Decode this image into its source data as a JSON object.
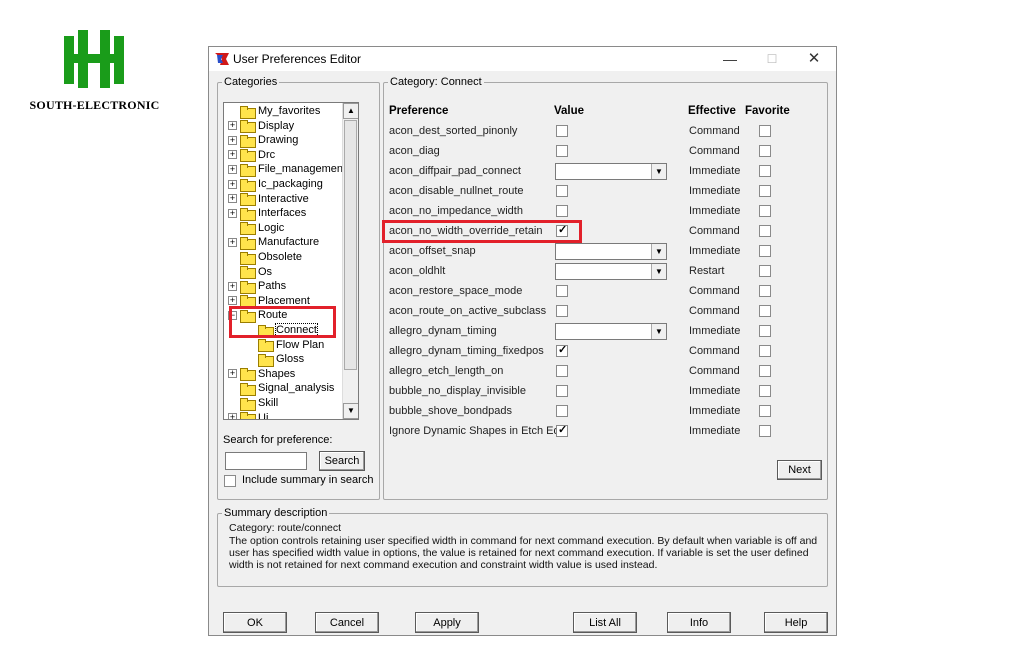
{
  "logo": {
    "text": "SOUTH-ELECTRONIC",
    "brand_color": "#1a9c1a"
  },
  "window": {
    "title": "User Preferences Editor",
    "controls": {
      "minimize": "—",
      "maximize": "☐",
      "close": "✕"
    }
  },
  "categories": {
    "legend": "Categories",
    "items": [
      {
        "label": "My_favorites",
        "expander": ""
      },
      {
        "label": "Display",
        "expander": "+"
      },
      {
        "label": "Drawing",
        "expander": "+"
      },
      {
        "label": "Drc",
        "expander": "+"
      },
      {
        "label": "File_management",
        "expander": "+"
      },
      {
        "label": "Ic_packaging",
        "expander": "+"
      },
      {
        "label": "Interactive",
        "expander": "+"
      },
      {
        "label": "Interfaces",
        "expander": "+"
      },
      {
        "label": "Logic",
        "expander": ""
      },
      {
        "label": "Manufacture",
        "expander": "+"
      },
      {
        "label": "Obsolete",
        "expander": ""
      },
      {
        "label": "Os",
        "expander": ""
      },
      {
        "label": "Paths",
        "expander": "+"
      },
      {
        "label": "Placement",
        "expander": "+"
      },
      {
        "label": "Route",
        "expander": "−"
      },
      {
        "label": "Connect",
        "expander": "",
        "child": true,
        "selected": true
      },
      {
        "label": "Flow Plan",
        "expander": "",
        "child": true
      },
      {
        "label": "Gloss",
        "expander": "",
        "child": true
      },
      {
        "label": "Shapes",
        "expander": "+"
      },
      {
        "label": "Signal_analysis",
        "expander": ""
      },
      {
        "label": "Skill",
        "expander": ""
      },
      {
        "label": "Ui",
        "expander": "+"
      }
    ],
    "search_label": "Search for preference:",
    "search_value": "",
    "search_button": "Search",
    "include_summary_label": "Include summary in search",
    "include_summary_checked": false
  },
  "detail": {
    "legend": "Category:  Connect",
    "headers": {
      "preference": "Preference",
      "value": "Value",
      "effective": "Effective",
      "favorite": "Favorite"
    },
    "rows": [
      {
        "name": "acon_dest_sorted_pinonly",
        "type": "check",
        "checked": false,
        "effective": "Command"
      },
      {
        "name": "acon_diag",
        "type": "check",
        "checked": false,
        "effective": "Command"
      },
      {
        "name": "acon_diffpair_pad_connect",
        "type": "select",
        "value": "",
        "effective": "Immediate"
      },
      {
        "name": "acon_disable_nullnet_route",
        "type": "check",
        "checked": false,
        "effective": "Immediate"
      },
      {
        "name": "acon_no_impedance_width",
        "type": "check",
        "checked": false,
        "effective": "Immediate"
      },
      {
        "name": "acon_no_width_override_retain",
        "type": "check",
        "checked": true,
        "effective": "Command",
        "highlight": true
      },
      {
        "name": "acon_offset_snap",
        "type": "select",
        "value": "",
        "effective": "Immediate"
      },
      {
        "name": "acon_oldhlt",
        "type": "select",
        "value": "",
        "effective": "Restart"
      },
      {
        "name": "acon_restore_space_mode",
        "type": "check",
        "checked": false,
        "effective": "Command"
      },
      {
        "name": "acon_route_on_active_subclass",
        "type": "check",
        "checked": false,
        "effective": "Command"
      },
      {
        "name": "allegro_dynam_timing",
        "type": "select",
        "value": "",
        "effective": "Immediate"
      },
      {
        "name": "allegro_dynam_timing_fixedpos",
        "type": "check",
        "checked": true,
        "effective": "Command"
      },
      {
        "name": "allegro_etch_length_on",
        "type": "check",
        "checked": false,
        "effective": "Command"
      },
      {
        "name": "bubble_no_display_invisible",
        "type": "check",
        "checked": false,
        "effective": "Immediate"
      },
      {
        "name": "bubble_shove_bondpads",
        "type": "check",
        "checked": false,
        "effective": "Immediate"
      },
      {
        "name": "Ignore Dynamic Shapes in Etch Edit",
        "type": "check",
        "checked": true,
        "effective": "Immediate"
      }
    ],
    "next_button": "Next"
  },
  "summary": {
    "legend": "Summary description",
    "category": "Category: route/connect",
    "text": "The option controls retaining user specified width in command for next command execution. By default when variable is off and user has specified width value in options, the value is retained for next command execution. If variable is set the user defined width is not retained for next command execution and constraint width value is used instead."
  },
  "buttons": {
    "ok": "OK",
    "cancel": "Cancel",
    "apply": "Apply",
    "list_all": "List All",
    "info": "Info",
    "help": "Help"
  },
  "accent_red": "#e2202a"
}
